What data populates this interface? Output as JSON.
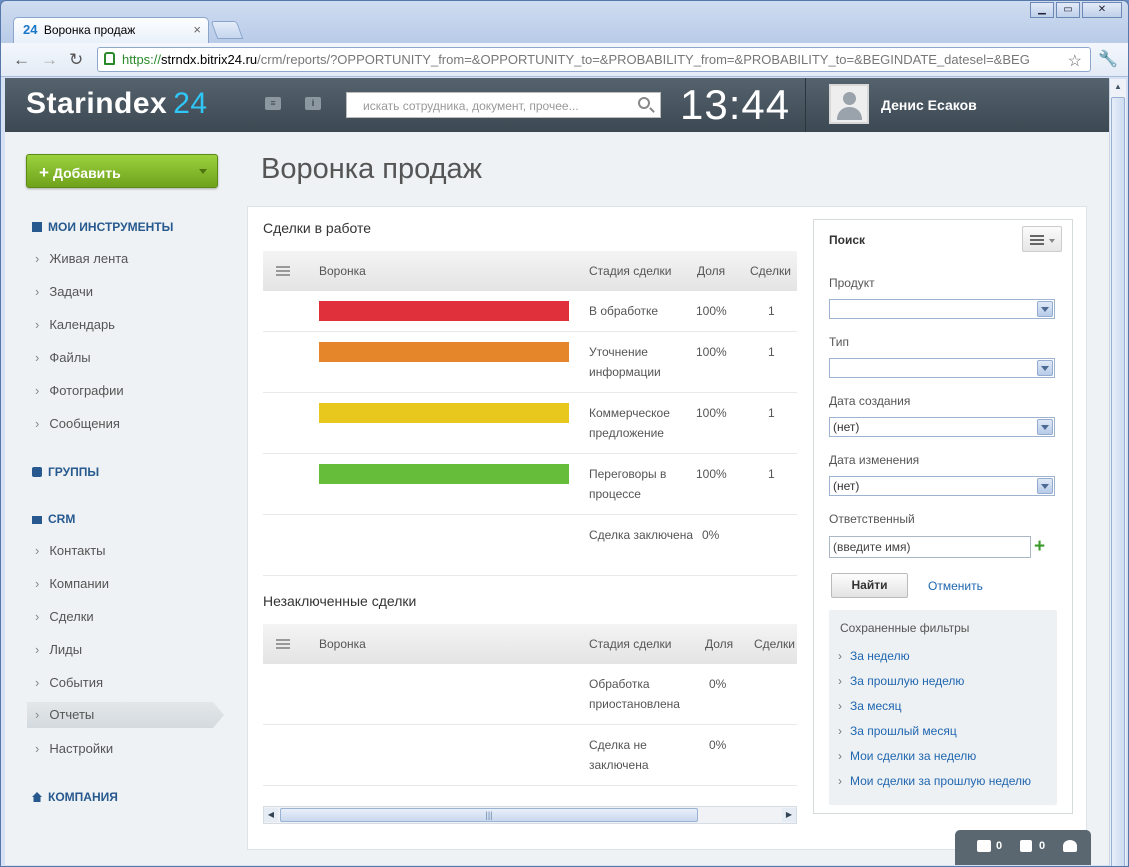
{
  "browser": {
    "tab_favicon": "24",
    "tab_title": "Воронка продаж",
    "url_scheme": "https://",
    "url_domain": "strndx.bitrix24.ru",
    "url_path": "/crm/reports/?OPPORTUNITY_from=&OPPORTUNITY_to=&PROBABILITY_from=&PROBABILITY_to=&BEGINDATE_datesel=&BEG"
  },
  "header": {
    "logo_text": "Starindex",
    "logo_num": "24",
    "search_placeholder": "искать сотрудника, документ, прочее...",
    "clock": "13:44",
    "user_name": "Денис Есаков"
  },
  "sidebar": {
    "add_label": "Добавить",
    "my_tools": "МОИ ИНСТРУМЕНТЫ",
    "tools": [
      "Живая лента",
      "Задачи",
      "Календарь",
      "Файлы",
      "Фотографии",
      "Сообщения"
    ],
    "groups": "ГРУППЫ",
    "crm": "CRM",
    "crm_items": [
      "Контакты",
      "Компании",
      "Сделки",
      "Лиды",
      "События",
      "Отчеты",
      "Настройки"
    ],
    "company": "КОМПАНИЯ"
  },
  "page_title": "Воронка продаж",
  "active_section": {
    "title": "Сделки в работе",
    "headers": [
      "Воронка",
      "Стадия сделки",
      "Доля",
      "Сделки"
    ],
    "rows": [
      {
        "color": "#e0303c",
        "stage": "В обработке",
        "pct": "100%",
        "count": "1"
      },
      {
        "color": "#e5862a",
        "stage": "Уточнение информации",
        "pct": "100%",
        "count": "1"
      },
      {
        "color": "#e8c81c",
        "stage": "Коммерческое предложение",
        "pct": "100%",
        "count": "1"
      },
      {
        "color": "#66bd3a",
        "stage": "Переговоры в процессе",
        "pct": "100%",
        "count": "1"
      },
      {
        "color": "",
        "stage": "Сделка заключена",
        "pct": "0%",
        "count": ""
      }
    ]
  },
  "closed_section": {
    "title": "Незаключенные сделки",
    "headers": [
      "Воронка",
      "Стадия сделки",
      "Доля",
      "Сделки"
    ],
    "rows": [
      {
        "stage": "Обработка приостановлена",
        "pct": "0%"
      },
      {
        "stage": "Сделка не заключена",
        "pct": "0%"
      }
    ]
  },
  "filter": {
    "title": "Поиск",
    "product_label": "Продукт",
    "type_label": "Тип",
    "created_label": "Дата создания",
    "created_value": "(нет)",
    "modified_label": "Дата изменения",
    "modified_value": "(нет)",
    "responsible_label": "Ответственный",
    "responsible_value": "(введите имя)",
    "find_label": "Найти",
    "cancel_label": "Отменить",
    "saved_title": "Сохраненные фильтры",
    "saved": [
      "За неделю",
      "За прошлую неделю",
      "За месяц",
      "За прошлый месяц",
      "Мои сделки за неделю",
      "Мои сделки за прошлую неделю"
    ]
  },
  "notifications": {
    "messages": "0",
    "info": "0"
  }
}
